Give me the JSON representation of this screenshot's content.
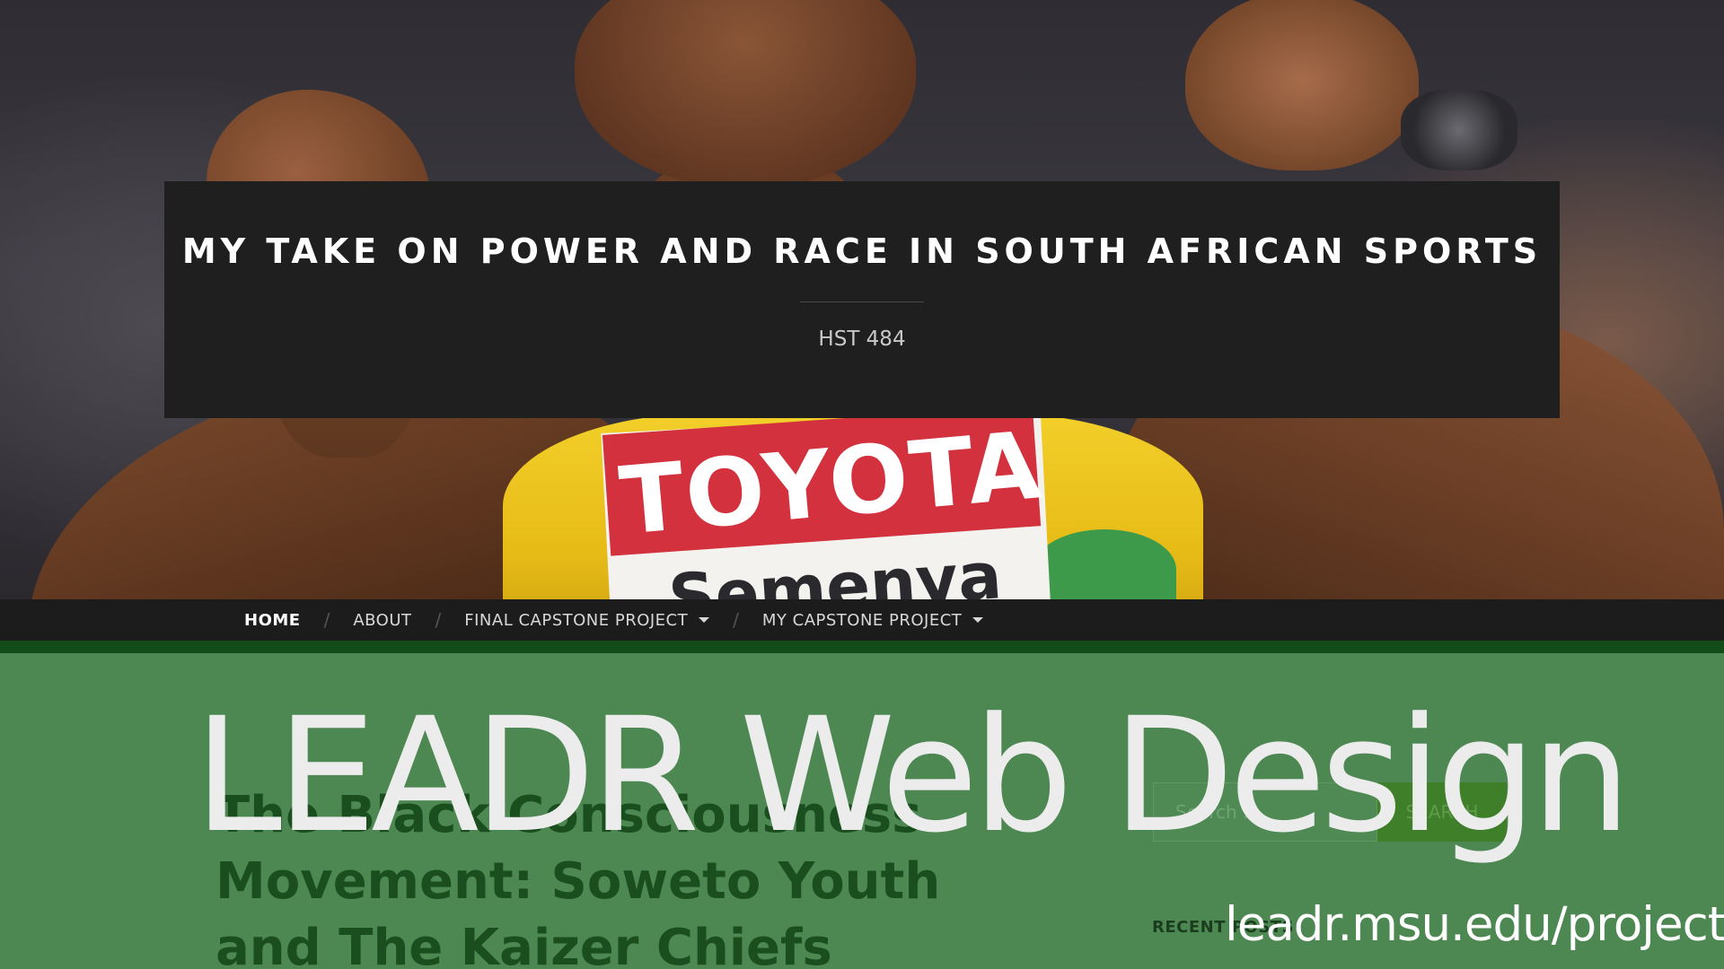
{
  "hero": {
    "bib_brand": "TOYOTA",
    "bib_name": "Semenya"
  },
  "header": {
    "site_title": "MY TAKE ON POWER AND RACE IN SOUTH AFRICAN SPORTS",
    "site_description": "HST 484"
  },
  "nav": {
    "items": [
      {
        "label": "HOME",
        "active": true,
        "has_dropdown": false
      },
      {
        "label": "ABOUT",
        "active": false,
        "has_dropdown": false
      },
      {
        "label": "FINAL CAPSTONE PROJECT",
        "active": false,
        "has_dropdown": true
      },
      {
        "label": "MY CAPSTONE PROJECT",
        "active": false,
        "has_dropdown": true
      }
    ],
    "separator": "/"
  },
  "post": {
    "title": "The Black Consciousness Movement: Soweto Youth and The Kaizer Chiefs"
  },
  "sidebar": {
    "search_placeholder": "Search …",
    "search_button": "SEARCH",
    "recent_label": "RECENT POSTS"
  },
  "overlay": {
    "title": "LEADR Web Design",
    "url": "leadr.msu.edu/projects"
  },
  "colors": {
    "overlay_green": "#4d8853",
    "band_dark_green": "#124d19",
    "title_box": "#1f1f1f",
    "nav_bg": "#1c1c1c",
    "bib_red": "#d2313d",
    "jersey_yellow": "#f2cf2a"
  }
}
